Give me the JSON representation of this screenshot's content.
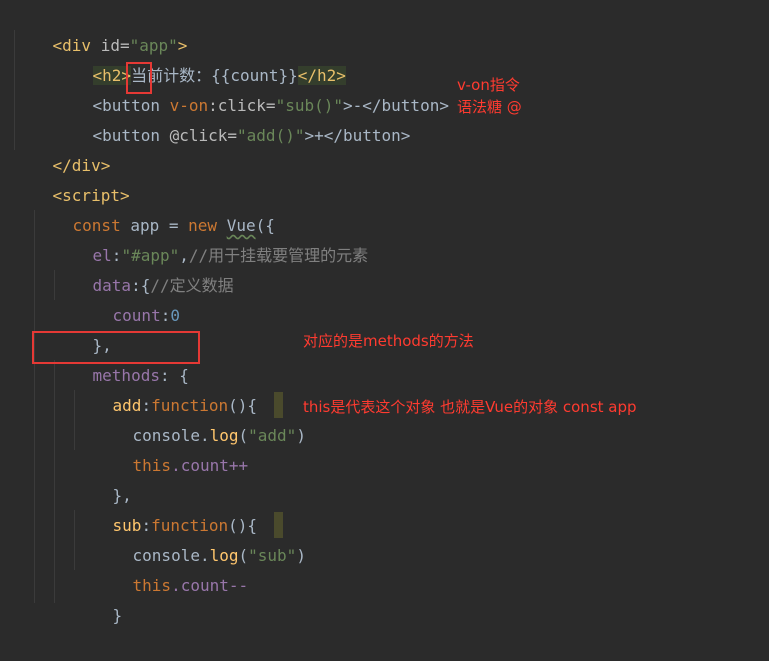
{
  "code": {
    "l1": {
      "open": "<div ",
      "attr": "id=",
      "val": "\"app\"",
      "close": ">"
    },
    "l2": {
      "open": "<h2>",
      "text": "当前计数：{{count}}",
      "close": "</h2>"
    },
    "l3": {
      "open": "<button ",
      "vo": "v-on",
      "attr": ":click=",
      "val": "\"sub()\"",
      "rest": ">-",
      "close": "</button>"
    },
    "l4": {
      "open": "<button ",
      "attr": "@click=",
      "val": "\"add()\"",
      "rest": ">+",
      "close": "</button>"
    },
    "l5": {
      "close": "</div>"
    },
    "l6": {
      "open": "<script>"
    },
    "l7": {
      "kw1": "const",
      "a": " app = ",
      "kw2": "new",
      "sp": " ",
      "vue": "Vue",
      "tail": "({"
    },
    "l8": {
      "prop": "el",
      "colon": ":",
      "val": "\"#app\"",
      "comma": ",",
      "cmt": "//用于挂载要管理的元素"
    },
    "l9": {
      "prop": "data",
      "brace": ":{",
      "cmt": "//定义数据"
    },
    "l10": {
      "prop": "count",
      "colon": ":",
      "num": "0"
    },
    "l11": {
      "text": "},"
    },
    "l12": {
      "prop": "methods",
      "rest": ": {"
    },
    "l13": {
      "prop": "add",
      "colon": ":",
      "kw": "function",
      "tail": "(){"
    },
    "l14": {
      "a": "console.",
      "fn": "log",
      "open": "(",
      "val": "\"add\"",
      "close": ")"
    },
    "l15": {
      "kw": "this",
      "rest": ".count++"
    },
    "l16": {
      "text": "},"
    },
    "l17": {
      "prop": "sub",
      "colon": ":",
      "kw": "function",
      "tail": "(){"
    },
    "l18": {
      "a": "console.",
      "fn": "log",
      "open": "(",
      "val": "\"sub\"",
      "close": ")"
    },
    "l19": {
      "kw": "this",
      "rest": ".count--"
    },
    "l20": {
      "text": "}"
    }
  },
  "annotations": {
    "von_title": "v-on指令",
    "von_sugar": "语法糖 @",
    "methods_note": "对应的是methods的方法",
    "this_note": "this是代表这个对象 也就是Vue的对象  const app"
  },
  "colors": {
    "background": "#2b2b2b",
    "annotation_red": "#ff3b30",
    "box_red": "#e53935",
    "tag": "#e8bf6a",
    "string": "#6a8759",
    "keyword": "#cc7832",
    "property": "#9876aa",
    "comment": "#808080"
  }
}
